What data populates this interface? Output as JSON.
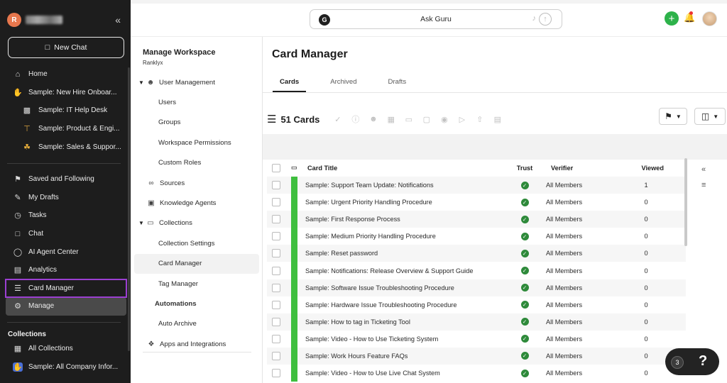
{
  "sidebar": {
    "avatar_letter": "R",
    "collapse_icon": "«",
    "new_chat_label": "New Chat",
    "items": [
      {
        "label": "Home",
        "icon": "home-icon"
      },
      {
        "label": "Sample: New Hire Onboar...",
        "icon": "wave-icon"
      },
      {
        "label": "Sample: IT Help Desk",
        "icon": "laptop-icon",
        "sub": true
      },
      {
        "label": "Sample: Product & Engi...",
        "icon": "crane-icon",
        "sub": true
      },
      {
        "label": "Sample: Sales & Suppor...",
        "icon": "handshake-icon",
        "sub": true
      }
    ],
    "items2": [
      {
        "label": "Saved and Following",
        "icon": "bookmark-icon"
      },
      {
        "label": "My Drafts",
        "icon": "pencil-icon"
      },
      {
        "label": "Tasks",
        "icon": "alarm-icon"
      },
      {
        "label": "Chat",
        "icon": "chat-icon"
      },
      {
        "label": "AI Agent Center",
        "icon": "agent-icon"
      },
      {
        "label": "Analytics",
        "icon": "chart-icon"
      },
      {
        "label": "Card Manager",
        "icon": "stack-icon"
      },
      {
        "label": "Manage",
        "icon": "gear-icon"
      }
    ],
    "collections_title": "Collections",
    "collections": [
      {
        "label": "All Collections",
        "icon": "grid-icon"
      },
      {
        "label": "Sample: All Company Infor...",
        "icon": "wave-icon"
      }
    ]
  },
  "topbar": {
    "ask_label": "Ask Guru",
    "guru_logo": "G",
    "plus": "+"
  },
  "workspace": {
    "title": "Manage Workspace",
    "subtitle": "Ranklyx",
    "items": [
      {
        "label": "User Management",
        "type": "parent"
      },
      {
        "label": "Users",
        "type": "child"
      },
      {
        "label": "Groups",
        "type": "child"
      },
      {
        "label": "Workspace Permissions",
        "type": "child"
      },
      {
        "label": "Custom Roles",
        "type": "child"
      },
      {
        "label": "Sources",
        "type": "top"
      },
      {
        "label": "Knowledge Agents",
        "type": "top"
      },
      {
        "label": "Collections",
        "type": "parent"
      },
      {
        "label": "Collection Settings",
        "type": "child"
      },
      {
        "label": "Card Manager",
        "type": "child"
      },
      {
        "label": "Tag Manager",
        "type": "child"
      },
      {
        "label": "Automations",
        "type": "cat"
      },
      {
        "label": "Auto Archive",
        "type": "child"
      },
      {
        "label": "Apps and Integrations",
        "type": "top"
      }
    ]
  },
  "main": {
    "title": "Card Manager",
    "tabs": [
      "Cards",
      "Archived",
      "Drafts"
    ],
    "card_count": "51 Cards",
    "columns": {
      "title": "Card Title",
      "trust": "Trust",
      "verifier": "Verifier",
      "viewed": "Viewed"
    },
    "rows": [
      {
        "title": "Sample: Support Team Update: Notifications",
        "verifier": "All Members",
        "viewed": "1"
      },
      {
        "title": "Sample: Urgent Priority Handling Procedure",
        "verifier": "All Members",
        "viewed": "0"
      },
      {
        "title": "Sample: First Response Process",
        "verifier": "All Members",
        "viewed": "0"
      },
      {
        "title": "Sample: Medium Priority Handling Procedure",
        "verifier": "All Members",
        "viewed": "0"
      },
      {
        "title": "Sample: Reset password",
        "verifier": "All Members",
        "viewed": "0"
      },
      {
        "title": "Sample: Notifications: Release Overview & Support Guide",
        "verifier": "All Members",
        "viewed": "0"
      },
      {
        "title": "Sample: Software Issue Troubleshooting Procedure",
        "verifier": "All Members",
        "viewed": "0"
      },
      {
        "title": "Sample: Hardware Issue Troubleshooting Procedure",
        "verifier": "All Members",
        "viewed": "0"
      },
      {
        "title": "Sample: How to tag in Ticketing Tool",
        "verifier": "All Members",
        "viewed": "0"
      },
      {
        "title": "Sample: Video - How to Use Ticketing System",
        "verifier": "All Members",
        "viewed": "0"
      },
      {
        "title": "Sample: Work Hours Feature FAQs",
        "verifier": "All Members",
        "viewed": "0"
      },
      {
        "title": "Sample: Video - How to Use Live Chat System",
        "verifier": "All Members",
        "viewed": "0"
      }
    ]
  },
  "help": {
    "badge": "3",
    "label": "?"
  }
}
